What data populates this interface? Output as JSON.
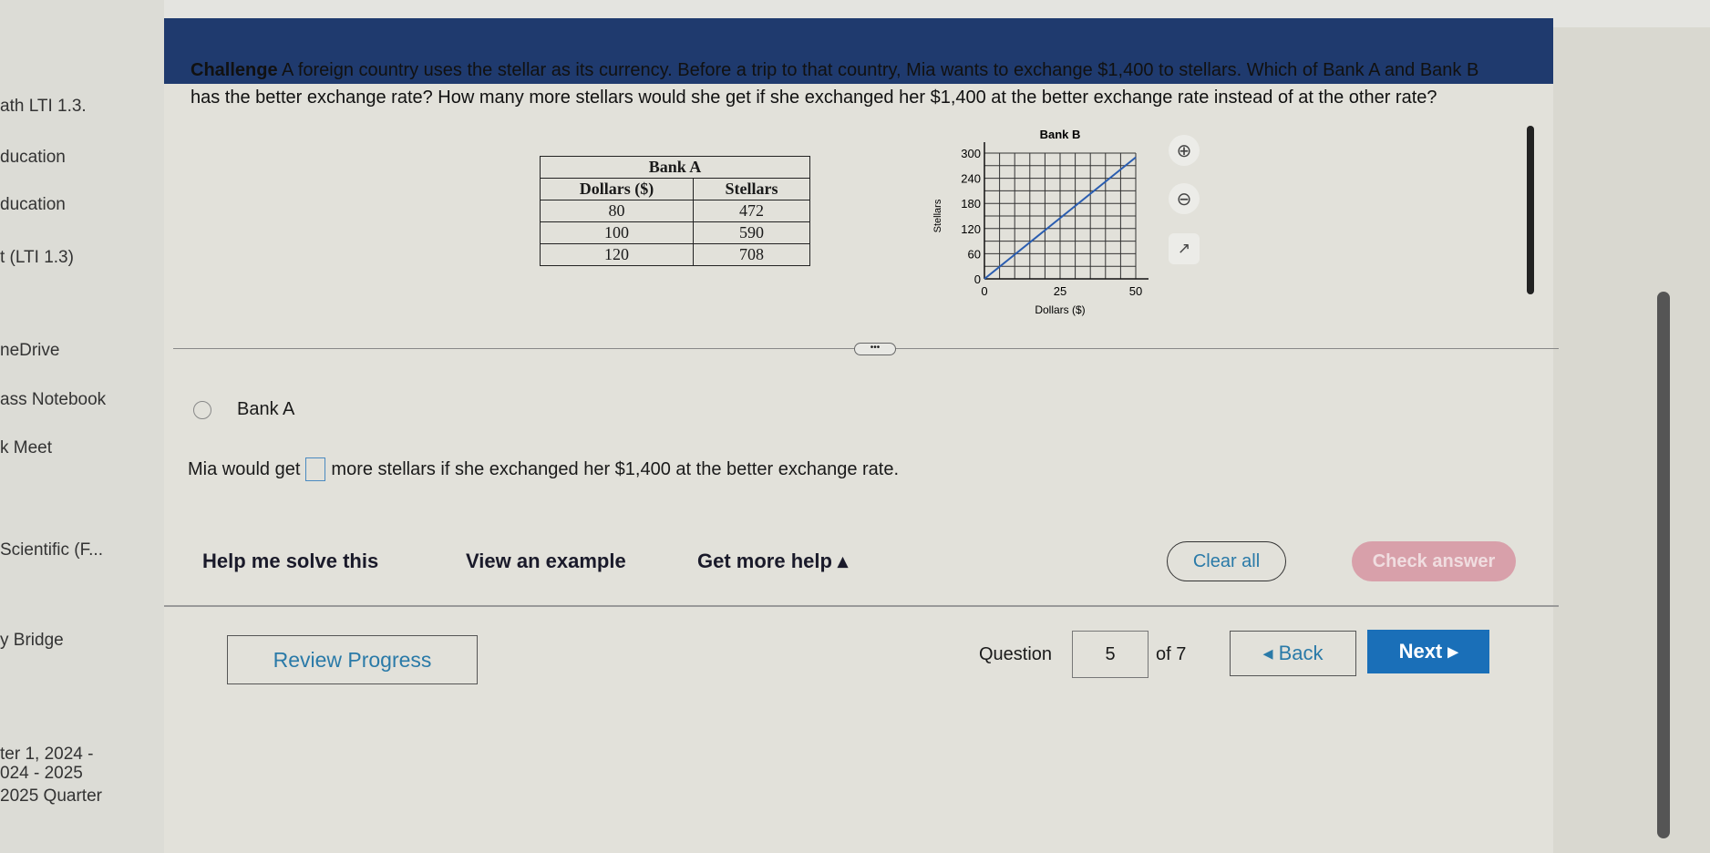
{
  "sidebar": {
    "items": [
      "ath LTI 1.3.",
      "ducation",
      "ducation",
      "t (LTI 1.3)",
      "neDrive",
      "ass Notebook",
      "k Meet",
      "Scientific (F...",
      "y Bridge",
      "ter 1, 2024 -",
      "024 - 2025",
      "2025 Quarter"
    ]
  },
  "question": {
    "label": "Challenge",
    "line1": "A foreign country uses the stellar as its currency. Before a trip to that country, Mia wants to exchange $1,400 to stellars. Which of Bank A and Bank B",
    "line2": "has the better exchange rate? How many more stellars would she get if she exchanged her $1,400 at the better exchange rate instead of at the other rate?"
  },
  "table": {
    "title": "Bank A",
    "headers": [
      "Dollars ($)",
      "Stellars"
    ],
    "rows": [
      [
        "80",
        "472"
      ],
      [
        "100",
        "590"
      ],
      [
        "120",
        "708"
      ]
    ]
  },
  "chart_data": {
    "type": "line",
    "title": "Bank B",
    "xlabel": "Dollars ($)",
    "ylabel": "Stellars",
    "xlim": [
      0,
      50
    ],
    "ylim": [
      0,
      300
    ],
    "xticks": [
      "0",
      "25",
      "50"
    ],
    "yticks": [
      "0",
      "60",
      "120",
      "180",
      "240",
      "300"
    ],
    "grid": true,
    "x": [
      0,
      50
    ],
    "y": [
      0,
      290
    ],
    "line_color": "#2a5db0"
  },
  "tools": {
    "zoom_in": "zoom-in-icon",
    "zoom_out": "zoom-out-icon",
    "popout": "popout-icon"
  },
  "answer": {
    "option": "Bank A",
    "sentence_before": "Mia would get",
    "sentence_after": "more stellars if she exchanged her $1,400 at the better exchange rate.",
    "blank_value": ""
  },
  "actions": {
    "help": "Help me solve this",
    "example": "View an example",
    "more_help": "Get more help ▴",
    "clear": "Clear all",
    "check": "Check answer"
  },
  "nav": {
    "review": "Review Progress",
    "question_label": "Question",
    "question_number": "5",
    "of_total": "of 7",
    "back": "◂ Back",
    "next": "Next ▸"
  },
  "colors": {
    "header": "#1f3a6e",
    "next": "#1a6fb8",
    "check": "#d8a0aa",
    "link": "#2a7aa8"
  }
}
